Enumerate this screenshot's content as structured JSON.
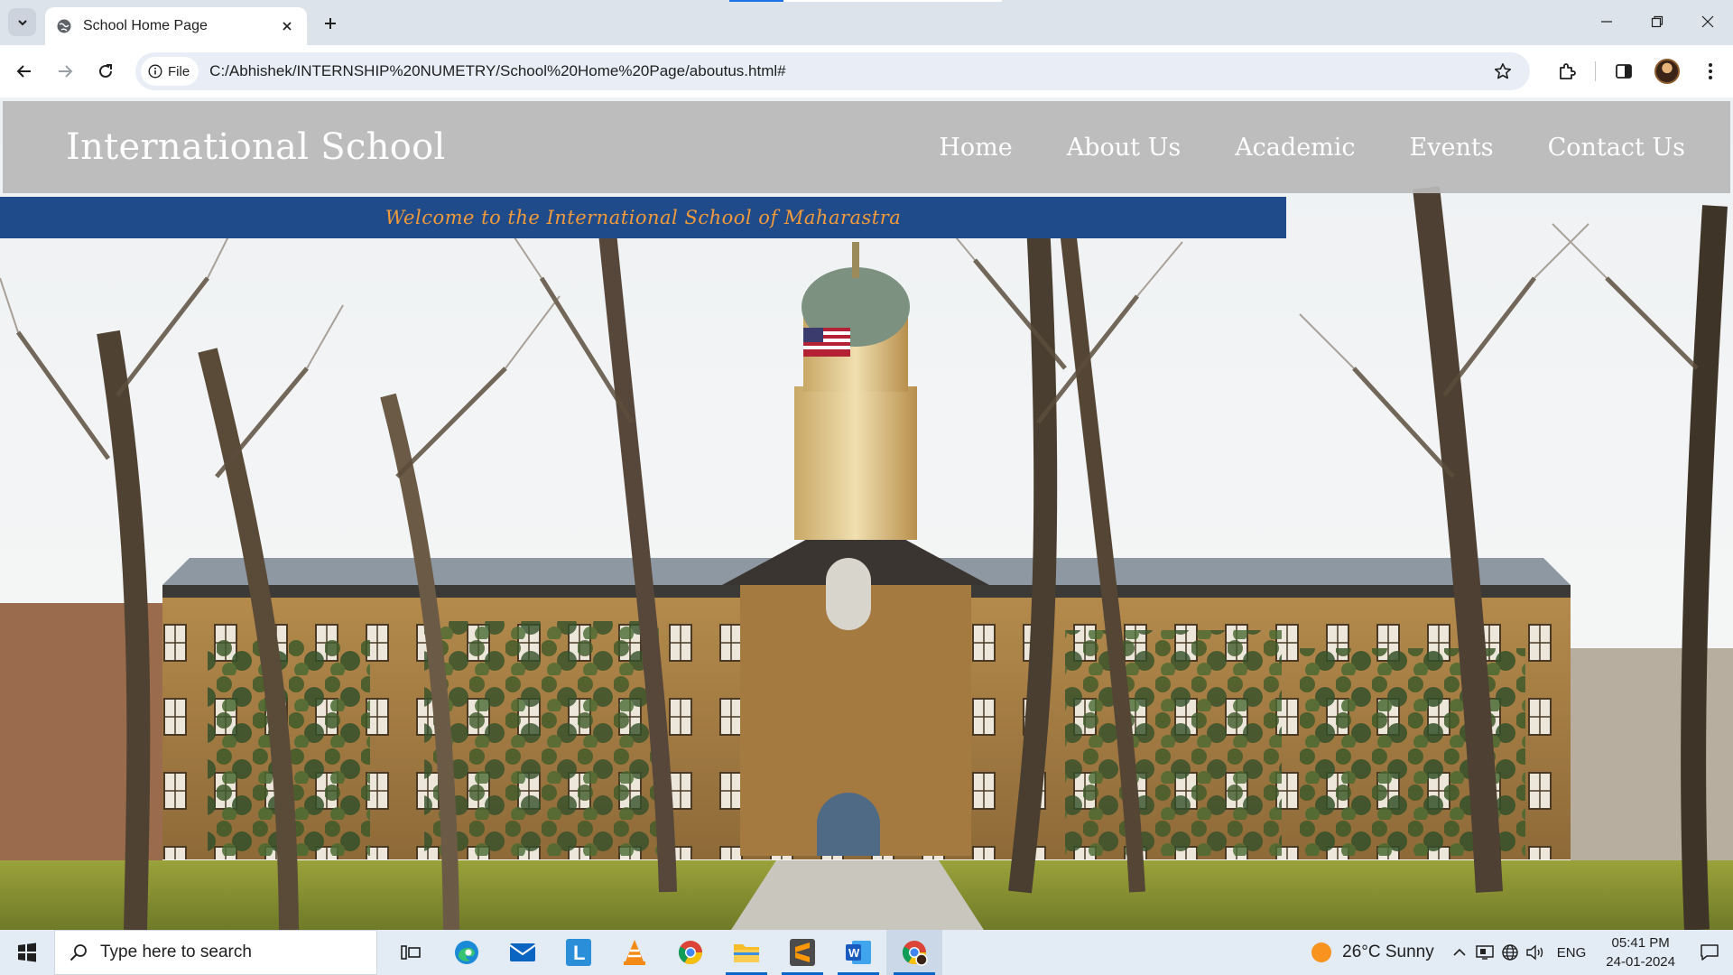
{
  "browser": {
    "tab": {
      "title": "School Home Page"
    },
    "address": {
      "chip_label": "File",
      "url": "C:/Abhishek/INTERNSHIP%20NUMETRY/School%20Home%20Page/aboutus.html#"
    }
  },
  "site": {
    "logo": "International School",
    "nav": [
      "Home",
      "About Us",
      "Academic",
      "Events",
      "Contact Us"
    ],
    "welcome": "Welcome to the International School of Maharastra"
  },
  "taskbar": {
    "search_placeholder": "Type here to search",
    "weather": "26°C  Sunny",
    "language": "ENG",
    "time": "05:41 PM",
    "date": "24-01-2024"
  },
  "colors": {
    "header_bg": "#b9b9b9",
    "welcome_bar": "#1f4b8a",
    "welcome_text": "#f39a3a"
  }
}
